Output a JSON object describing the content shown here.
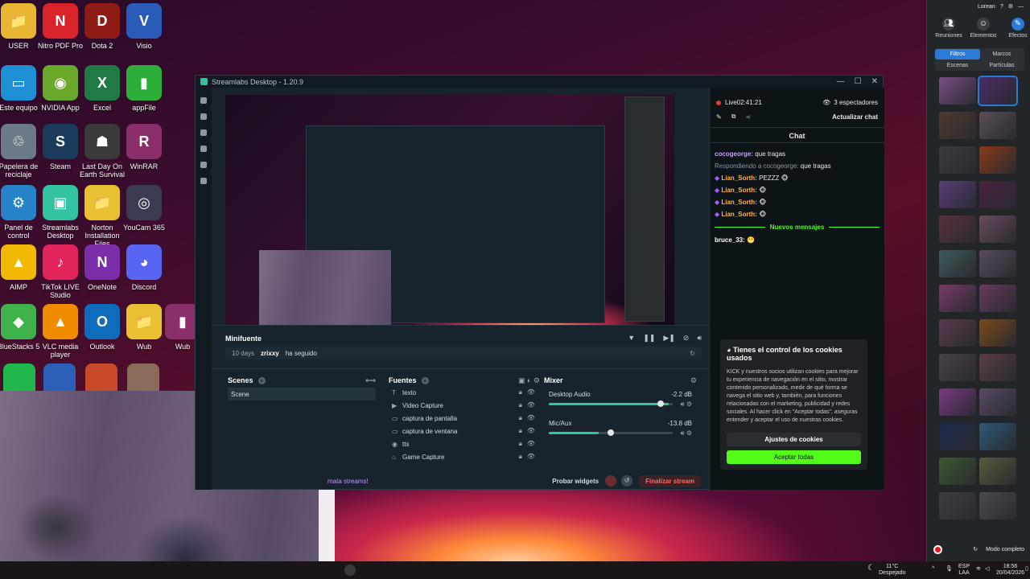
{
  "desktop_icons": [
    {
      "label": "USER",
      "glyph": "📁",
      "color": "#e8b632"
    },
    {
      "label": "Nitro PDF Pro",
      "glyph": "N",
      "color": "#d9242b"
    },
    {
      "label": "Dota 2",
      "glyph": "D",
      "color": "#8e1b14"
    },
    {
      "label": "Visio",
      "glyph": "V",
      "color": "#2a5bb8"
    },
    {
      "label": "Este equipo",
      "glyph": "▭",
      "color": "#1f8fd6"
    },
    {
      "label": "NVIDIA App",
      "glyph": "◉",
      "color": "#6aa829"
    },
    {
      "label": "Excel",
      "glyph": "X",
      "color": "#1f7a43"
    },
    {
      "label": "appFile",
      "glyph": "▮",
      "color": "#2dae3a"
    },
    {
      "label": "Papelera de reciclaje",
      "glyph": "♲",
      "color": "#6b7a86"
    },
    {
      "label": "Steam",
      "glyph": "S",
      "color": "#1b3a5c"
    },
    {
      "label": "Last Day On Earth Survival",
      "glyph": "☗",
      "color": "#3a3a3a"
    },
    {
      "label": "WinRAR",
      "glyph": "R",
      "color": "#8b2f6a"
    },
    {
      "label": "Panel de control",
      "glyph": "⚙",
      "color": "#2783c8"
    },
    {
      "label": "Streamlabs Desktop",
      "glyph": "▣",
      "color": "#31c3a2"
    },
    {
      "label": "Norton Installation Files",
      "glyph": "📁",
      "color": "#e8c032"
    },
    {
      "label": "YouCam 365",
      "glyph": "◎",
      "color": "#3b3b52"
    },
    {
      "label": "AIMP",
      "glyph": "▲",
      "color": "#f0b800"
    },
    {
      "label": "TikTok LIVE Studio",
      "glyph": "♪",
      "color": "#e3245a"
    },
    {
      "label": "OneNote",
      "glyph": "N",
      "color": "#7a2ea8"
    },
    {
      "label": "Discord",
      "glyph": "◕",
      "color": "#5865f2"
    },
    {
      "label": "BlueStacks 5",
      "glyph": "◆",
      "color": "#3fb24b"
    },
    {
      "label": "VLC media player",
      "glyph": "▲",
      "color": "#f08b00"
    },
    {
      "label": "Outlook",
      "glyph": "O",
      "color": "#0f6cbd"
    },
    {
      "label": "Wub",
      "glyph": "📁",
      "color": "#e8c032"
    },
    {
      "label": "Wub",
      "glyph": "▮",
      "color": "#8b2f6a"
    }
  ],
  "streamlabs": {
    "title": "Streamlabs Desktop - 1.20.9",
    "minifuente_title": "Minifuente",
    "feed_days": "10 days",
    "feed_user": "zrixxy",
    "feed_action": "ha seguido",
    "scenes_title": "Scenes",
    "scene_item": "Scene",
    "fuentes_title": "Fuentes",
    "sources": [
      "texto",
      "Video Capture",
      "captura de pantalla",
      "captura de ventana",
      "tts",
      "Game Capture"
    ],
    "mixer_title": "Mixer",
    "mixer": [
      {
        "name": "Desktop Audio",
        "db": "-2.2 dB",
        "level": 0.97,
        "volume": 0.9
      },
      {
        "name": "Mic/Aux",
        "db": "-13.8 dB",
        "level": 0.4,
        "volume": 0.5
      }
    ],
    "footer_left": "mata streams!",
    "probar_widgets": "Probar widgets",
    "finalizar": "Finalizar stream",
    "live_label": "Live02:41:21",
    "viewers": "3 espectadores",
    "actualizar_chat": "Actualizar chat",
    "chat_title": "Chat",
    "chat_messages": [
      {
        "user": "cocogeorge:",
        "text": "que tragas",
        "color": "#c9a0ff"
      },
      {
        "user": "Respondiendo a cocogeorge:",
        "text": "que tragas",
        "color": "#8d959c"
      },
      {
        "user": "Lian_Sorth:",
        "text": "PEZZZ",
        "color": "#ffb347"
      },
      {
        "user": "Lian_Sorth:",
        "text": "",
        "color": "#ffb347"
      },
      {
        "user": "Lian_Sorth:",
        "text": "",
        "color": "#ffb347"
      },
      {
        "user": "Lian_Sorth:",
        "text": "",
        "color": "#ffb347"
      }
    ],
    "nuevos": "Nuevos mensajes",
    "last_msg_user": "bruce_33:",
    "cookie_title": "Tienes el control de los cookies usados",
    "cookie_body": "KICK y nuestros socios utilizan cookies para mejorar tu experiencia de navegación en el sitio, mostrar contenido personalizado, medir de qué forma se navega el sitio web y, también, para funciones relacionadas con el marketing, publicidad y redes sociales. Al hacer click en \"Aceptar todas\", aseguras entender y aceptar el uso de nuestras cookies.",
    "cookie_settings": "Ajustes de cookies",
    "cookie_accept": "Aceptar todas"
  },
  "effects_panel": {
    "user": "Lorean",
    "tabs": [
      "Reuniones",
      "Elementos",
      "Efectos"
    ],
    "seg_top": [
      "Filtros",
      "Marcos"
    ],
    "seg_bottom": [
      "Escenas",
      "Partículas"
    ],
    "fullscreen": "Modo completo",
    "thumb_colors": [
      "#7a4f86",
      "#4a2b66",
      "#4e3a2e",
      "#5b4f56",
      "#3a3a40",
      "#8a3a18",
      "#5a3e7a",
      "#4a2240",
      "#5a3040",
      "#6a4a5e",
      "#3e5a5a",
      "#5a4a5a",
      "#7a3a68",
      "#6a3a5e",
      "#5a3a4e",
      "#7a4a18",
      "#4a4048",
      "#5a3e48",
      "#7a3a82",
      "#5a4a66",
      "#1a2a4e",
      "#2e5a78",
      "#3a5a30",
      "#5a5a3a",
      "#3e3e42",
      "#4a4a4e"
    ]
  },
  "taskbar": {
    "weather_temp": "11°C",
    "weather_desc": "Despejado",
    "lang1": "ESP",
    "lang2": "LAA",
    "time": "18:56",
    "date": "20/04/2026"
  }
}
